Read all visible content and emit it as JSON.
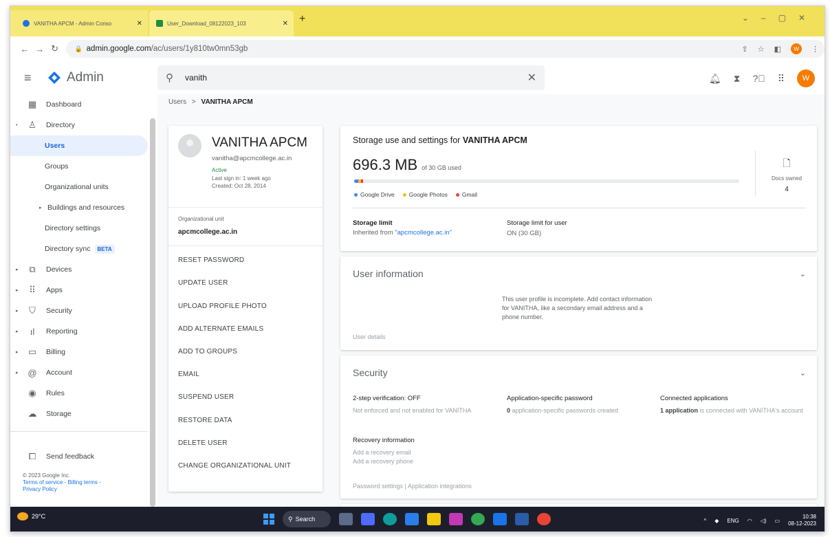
{
  "browser": {
    "tabs": [
      {
        "title": "VANITHA APCM - Admin Conso",
        "active": false
      },
      {
        "title": "User_Download_08122023_103",
        "active": true
      }
    ],
    "url_host": "admin.google.com",
    "url_path": "/ac/users/1y810tw0mn53gb",
    "profile_initial": "W"
  },
  "header": {
    "app_name": "Admin",
    "search_value": "vanith",
    "avatar_initial": "W",
    "icons": [
      "bell-icon",
      "hourglass-icon",
      "help-icon",
      "apps-grid-icon"
    ]
  },
  "sidebar": {
    "items": [
      {
        "label": "Dashboard",
        "icon": "dashboard-icon",
        "level": 0
      },
      {
        "label": "Directory",
        "icon": "person-icon",
        "level": 0,
        "expanded": true
      },
      {
        "label": "Users",
        "level": 1,
        "active": true
      },
      {
        "label": "Groups",
        "level": 1
      },
      {
        "label": "Organizational units",
        "level": 1
      },
      {
        "label": "Buildings and resources",
        "level": 1,
        "expandable": true
      },
      {
        "label": "Directory settings",
        "level": 1
      },
      {
        "label": "Directory sync",
        "level": 1,
        "badge": "BETA"
      },
      {
        "label": "Devices",
        "icon": "devices-icon",
        "level": 0
      },
      {
        "label": "Apps",
        "icon": "apps-icon",
        "level": 0
      },
      {
        "label": "Security",
        "icon": "shield-icon",
        "level": 0
      },
      {
        "label": "Reporting",
        "icon": "bar-chart-icon",
        "level": 0
      },
      {
        "label": "Billing",
        "icon": "credit-card-icon",
        "level": 0
      },
      {
        "label": "Account",
        "icon": "at-icon",
        "level": 0
      },
      {
        "label": "Rules",
        "icon": "rules-icon",
        "level": 0
      },
      {
        "label": "Storage",
        "icon": "cloud-icon",
        "level": 0
      }
    ],
    "feedback": "Send feedback",
    "footer_copyright": "© 2023 Google Inc.",
    "footer_links": "Terms of service - Billing terms -",
    "footer_privacy": "Privacy Policy"
  },
  "breadcrumb": {
    "parent": "Users",
    "separator": ">",
    "current": "VANITHA APCM"
  },
  "profile": {
    "name": "VANITHA APCM",
    "email": "vanitha@apcmcollege.ac.in",
    "status": "Active",
    "last_sign_in": "Last sign in: 1 week ago",
    "created": "Created: Oct 28, 2014",
    "org_unit_label": "Organizational unit",
    "org_unit": "apcmcollege.ac.in",
    "actions": [
      "RESET PASSWORD",
      "UPDATE USER",
      "UPLOAD PROFILE PHOTO",
      "ADD ALTERNATE EMAILS",
      "ADD TO GROUPS",
      "EMAIL",
      "SUSPEND USER",
      "RESTORE DATA",
      "DELETE USER",
      "CHANGE ORGANIZATIONAL UNIT"
    ]
  },
  "storage": {
    "title_prefix": "Storage use and settings for",
    "title_name": "VANITHA APCM",
    "used": "696.3 MB",
    "of_total": "of 30 GB used",
    "usage_fraction": 0.0227,
    "legend": [
      {
        "label": "Google Drive",
        "color": "#4285f4"
      },
      {
        "label": "Google Photos",
        "color": "#fbbc04"
      },
      {
        "label": "Gmail",
        "color": "#ea4335"
      }
    ],
    "docs_label": "Docs owned",
    "docs_count": "4",
    "limit_label": "Storage limit",
    "limit_value_prefix": "Inherited from",
    "limit_value_link": "\"apcmcollege.ac.in\"",
    "user_limit_label": "Storage limit for user",
    "user_limit_value": "ON (30 GB)"
  },
  "user_info": {
    "title": "User information",
    "message": "This user profile is incomplete. Add contact information for VANITHA, like a secondary email address and a phone number.",
    "details": "User details"
  },
  "security": {
    "title": "Security",
    "two_step_label": "2-step verification: OFF",
    "two_step_text": "Not enforced and not enabled for VANITHA",
    "app_pw_label": "Application-specific password",
    "app_pw_count": "0",
    "app_pw_text": "application-specific passwords created",
    "connected_label": "Connected applications",
    "connected_count": "1 application",
    "connected_text": "is connected with VANITHA's account",
    "recovery_label": "Recovery information",
    "recovery_email": "Add a recovery email",
    "recovery_phone": "Add a recovery phone",
    "footer": "Password settings | Application integrations"
  },
  "taskbar": {
    "temperature": "29°C",
    "search_label": "Search",
    "lang": "ENG",
    "time": "10:38",
    "date": "08-12-2023"
  }
}
